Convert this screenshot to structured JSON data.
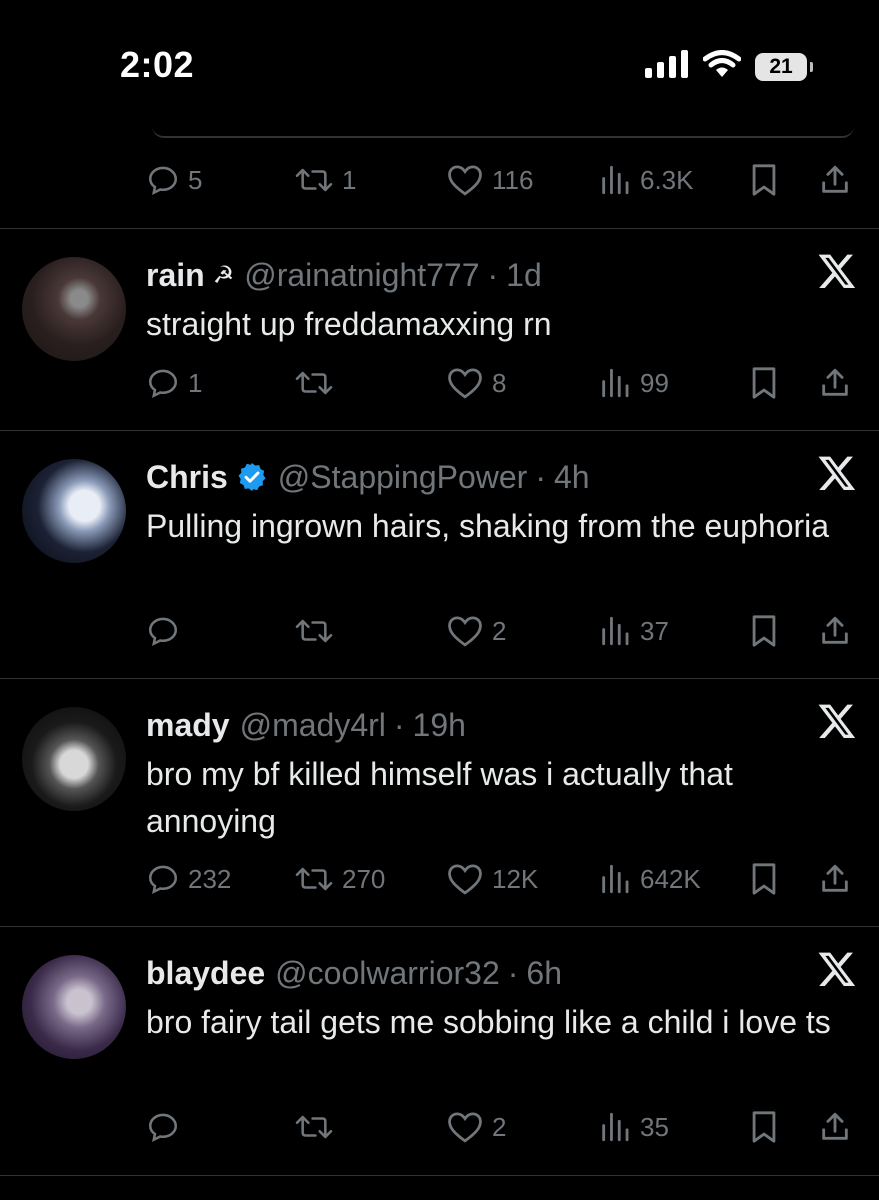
{
  "status_bar": {
    "time": "2:02",
    "battery": "21"
  },
  "top_actions": {
    "replies": "5",
    "retweets": "1",
    "likes": "116",
    "views": "6.3K"
  },
  "tweets": [
    {
      "name": "rain",
      "name_badge": "☭",
      "handle": "@rainatnight777",
      "time": "1d",
      "text": "straight up freddamaxxing rn",
      "replies": "1",
      "retweets": "",
      "likes": "8",
      "views": "99"
    },
    {
      "name": "Chris",
      "verified": true,
      "handle": "@StappingPower",
      "time": "4h",
      "text": "Pulling ingrown hairs, shaking from the euphoria",
      "replies": "",
      "retweets": "",
      "likes": "2",
      "views": "37"
    },
    {
      "name": "mady",
      "handle": "@mady4rl",
      "time": "19h",
      "text": "bro my bf killed himself was i actually that annoying",
      "replies": "232",
      "retweets": "270",
      "likes": "12K",
      "views": "642K"
    },
    {
      "name": "blaydee",
      "handle": "@coolwarrior32",
      "time": "6h",
      "text": "bro fairy tail gets me sobbing like a child i love ts",
      "replies": "",
      "retweets": "",
      "likes": "2",
      "views": "35"
    }
  ],
  "colors": {
    "background": "#000000",
    "text": "#e7e9ea",
    "secondary": "#71767b",
    "divider": "#2f3336",
    "verified": "#1d9bf0"
  }
}
